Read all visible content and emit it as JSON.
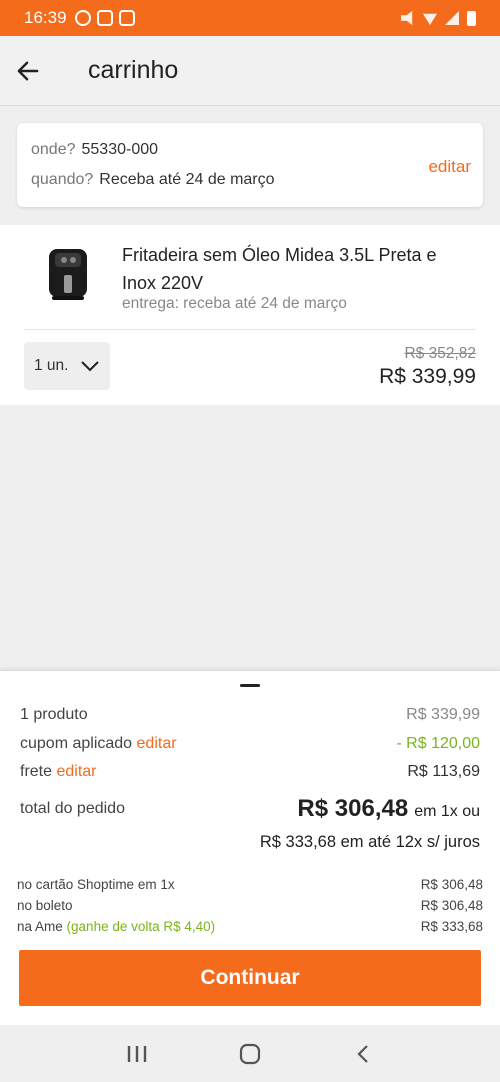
{
  "status": {
    "time": "16:39"
  },
  "header": {
    "title": "carrinho"
  },
  "delivery": {
    "where_label": "onde?",
    "where_value": "55330-000",
    "when_label": "quando?",
    "when_value": "Receba até 24 de março",
    "edit_label": "editar"
  },
  "product": {
    "name": "Fritadeira sem Óleo Midea 3.5L Preta e Inox 220V",
    "delivery": "entrega: receba até 24 de março",
    "quantity": "1 un.",
    "old_price": "R$ 352,82",
    "price": "R$ 339,99"
  },
  "summary": {
    "products_label": "1 produto",
    "products_value": "R$ 339,99",
    "coupon_label": "cupom aplicado",
    "coupon_edit": "editar",
    "coupon_value": "- R$ 120,00",
    "shipping_label": "frete",
    "shipping_edit": "editar",
    "shipping_value": "R$ 113,69",
    "total_label": "total do pedido",
    "total_value": "R$ 306,48",
    "total_suffix": "em 1x ou",
    "installments": "R$ 333,68 em até 12x s/ juros",
    "options": [
      {
        "label": "no cartão Shoptime em 1x",
        "extra": "",
        "value": "R$ 306,48"
      },
      {
        "label": "no boleto",
        "extra": "",
        "value": "R$ 306,48"
      },
      {
        "label": "na Ame",
        "extra": "(ganhe de volta R$ 4,40)",
        "value": "R$ 333,68"
      }
    ]
  },
  "actions": {
    "continue_label": "Continuar"
  },
  "colors": {
    "accent": "#f46b1c",
    "green": "#7ab51d"
  }
}
